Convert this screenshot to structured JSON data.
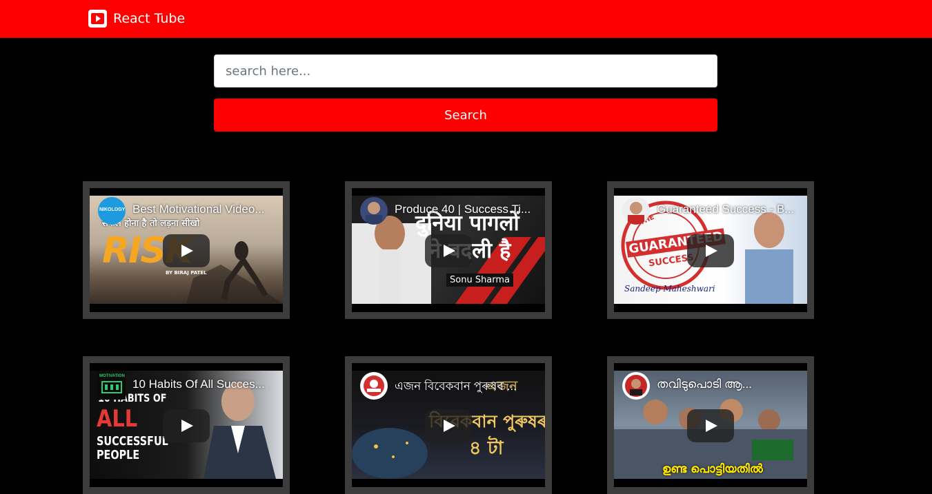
{
  "navbar": {
    "brand": "React Tube",
    "icon": "youtube-play-icon",
    "color": "#ff0000"
  },
  "search": {
    "placeholder": "search here...",
    "value": "",
    "button_label": "Search"
  },
  "videos": [
    {
      "title": "Best Motivational Video...",
      "channel": "NIKOLOGY",
      "overlay_top": "सफल होना है तो लड़ना सीखो",
      "overlay_main": "RISK",
      "overlay_small": "BY BIRAJ PATEL"
    },
    {
      "title": "Produce 40 | Success Ti...",
      "overlay_main": "दुनिया पागलों",
      "overlay_second": "ने बदली है",
      "overlay_name": "Sonu Sharma"
    },
    {
      "title": "Guaranteed Success - B...",
      "overlay_main": "GUARANTEED",
      "overlay_second": "SUCCESS",
      "overlay_stamp_top": "THE",
      "overlay_signature": "Sandeep Maheshwari"
    },
    {
      "title": "10 Habits Of All Succes...",
      "channel": "MOTIVATION",
      "overlay_top": "10 HABITS OF",
      "overlay_main": "ALL",
      "overlay_second": "SUCCESSFUL",
      "overlay_third": "PEOPLE"
    },
    {
      "title": "এজন বিবেকবান পুৰুষৰ ...",
      "overlay_top": "এজন",
      "overlay_main": "বিবেকবান পুৰুষৰ",
      "overlay_second": "৪ টা"
    },
    {
      "title": "തവിടുപൊടി ആ...",
      "overlay_main": "ഉണ്ട പൊട്ടിയതിൽ"
    }
  ],
  "colors": {
    "accent": "#ff0000",
    "background": "#000000",
    "card_border": "#3c3c3c"
  }
}
